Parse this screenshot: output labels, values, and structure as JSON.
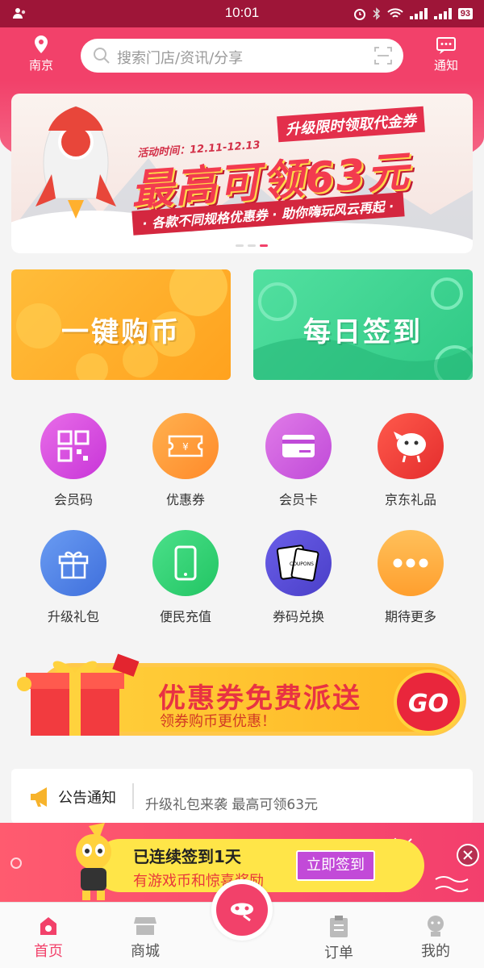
{
  "status_bar": {
    "time": "10:01",
    "battery": "93"
  },
  "header": {
    "location": "南京",
    "search_placeholder": "搜索门店/资讯/分享",
    "notify_label": "通知"
  },
  "banner": {
    "event_time": "活动时间：12.11-12.13",
    "tag": "升级限时领取代金券",
    "headline": "最高可领63元",
    "subline": "· 各款不同规格优惠券 · 助你嗨玩风云再起 ·"
  },
  "quick_cards": {
    "buy_coins": "一键购币",
    "daily_signin": "每日签到"
  },
  "grid": [
    {
      "label": "会员码",
      "icon": "qrcode-icon",
      "color": "#d94be0"
    },
    {
      "label": "优惠券",
      "icon": "ticket-icon",
      "color": "#ff9a3c"
    },
    {
      "label": "会员卡",
      "icon": "card-icon",
      "color": "#cf4fe0"
    },
    {
      "label": "京东礼品",
      "icon": "jd-dog-icon",
      "color": "#ef3d35"
    },
    {
      "label": "升级礼包",
      "icon": "gift-icon",
      "color": "#4b7fe6"
    },
    {
      "label": "便民充值",
      "icon": "phone-icon",
      "color": "#2fcf70"
    },
    {
      "label": "券码兑换",
      "icon": "coupons-icon",
      "color": "#5c4fd6"
    },
    {
      "label": "期待更多",
      "icon": "more-icon",
      "color": "#ffb14a"
    }
  ],
  "promo": {
    "title": "优惠券免费派送",
    "subtitle": "领券购币更优惠！",
    "go": "GO"
  },
  "notice": {
    "label": "公告通知",
    "text": "升级礼包来袭 最高可领63元"
  },
  "checkin": {
    "line1": "已连续签到1天",
    "line2": "有游戏币和惊喜奖励",
    "button": "立即签到"
  },
  "tabs": {
    "home": "首页",
    "mall": "商城",
    "orders": "订单",
    "mine": "我的"
  },
  "colors": {
    "brand": "#f2416a",
    "status_bar": "#9e1538"
  }
}
